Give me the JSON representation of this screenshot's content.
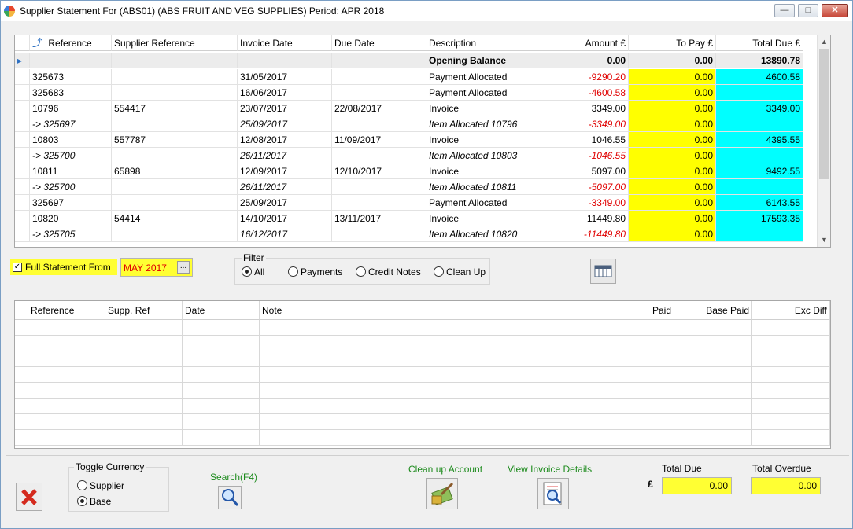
{
  "window": {
    "title": "Supplier Statement For (ABS01) (ABS  FRUIT AND VEG SUPPLIES) Period: APR 2018"
  },
  "statement_grid": {
    "columns": [
      "Reference",
      "Supplier Reference",
      "Invoice Date",
      "Due Date",
      "Description",
      "Amount £",
      "To Pay £",
      "Total Due £"
    ],
    "opening": {
      "description": "Opening Balance",
      "amount": "0.00",
      "to_pay": "0.00",
      "total_due": "13890.78"
    },
    "rows": [
      {
        "ref": "325673",
        "supp_ref": "",
        "inv_date": "31/05/2017",
        "due_date": "",
        "desc": "Payment Allocated",
        "amount": "-9290.20",
        "to_pay": "0.00",
        "total_due": "4600.58",
        "italic": false
      },
      {
        "ref": "325683",
        "supp_ref": "",
        "inv_date": "16/06/2017",
        "due_date": "",
        "desc": "Payment Allocated",
        "amount": "-4600.58",
        "to_pay": "0.00",
        "total_due": "",
        "italic": false
      },
      {
        "ref": "10796",
        "supp_ref": "554417",
        "inv_date": "23/07/2017",
        "due_date": "22/08/2017",
        "desc": "Invoice",
        "amount": "3349.00",
        "to_pay": "0.00",
        "total_due": "3349.00",
        "italic": false
      },
      {
        "ref": "-> 325697",
        "supp_ref": "",
        "inv_date": "25/09/2017",
        "due_date": "",
        "desc": "Item Allocated 10796",
        "amount": "-3349.00",
        "to_pay": "0.00",
        "total_due": "",
        "italic": true
      },
      {
        "ref": "10803",
        "supp_ref": "557787",
        "inv_date": "12/08/2017",
        "due_date": "11/09/2017",
        "desc": "Invoice",
        "amount": "1046.55",
        "to_pay": "0.00",
        "total_due": "4395.55",
        "italic": false
      },
      {
        "ref": "-> 325700",
        "supp_ref": "",
        "inv_date": "26/11/2017",
        "due_date": "",
        "desc": "Item Allocated 10803",
        "amount": "-1046.55",
        "to_pay": "0.00",
        "total_due": "",
        "italic": true
      },
      {
        "ref": "10811",
        "supp_ref": "65898",
        "inv_date": "12/09/2017",
        "due_date": "12/10/2017",
        "desc": "Invoice",
        "amount": "5097.00",
        "to_pay": "0.00",
        "total_due": "9492.55",
        "italic": false
      },
      {
        "ref": "-> 325700",
        "supp_ref": "",
        "inv_date": "26/11/2017",
        "due_date": "",
        "desc": "Item Allocated 10811",
        "amount": "-5097.00",
        "to_pay": "0.00",
        "total_due": "",
        "italic": true
      },
      {
        "ref": "325697",
        "supp_ref": "",
        "inv_date": "25/09/2017",
        "due_date": "",
        "desc": "Payment Allocated",
        "amount": "-3349.00",
        "to_pay": "0.00",
        "total_due": "6143.55",
        "italic": false
      },
      {
        "ref": "10820",
        "supp_ref": "54414",
        "inv_date": "14/10/2017",
        "due_date": "13/11/2017",
        "desc": "Invoice",
        "amount": "11449.80",
        "to_pay": "0.00",
        "total_due": "17593.35",
        "italic": false
      },
      {
        "ref": "-> 325705",
        "supp_ref": "",
        "inv_date": "16/12/2017",
        "due_date": "",
        "desc": "Item Allocated 10820",
        "amount": "-11449.80",
        "to_pay": "0.00",
        "total_due": "",
        "italic": true
      }
    ]
  },
  "statement_options": {
    "full_statement_label": "Full Statement From",
    "full_statement_checked": true,
    "from_date": "MAY 2017",
    "date_picker_label": "...",
    "filter_legend": "Filter",
    "filters": [
      "All",
      "Payments",
      "Credit Notes",
      "Clean Up"
    ],
    "selected_filter": "All"
  },
  "allocation_grid": {
    "columns": [
      "Reference",
      "Supp. Ref",
      "Date",
      "Note",
      "Paid",
      "Base Paid",
      "Exc Diff"
    ]
  },
  "footer": {
    "toggle_currency_legend": "Toggle Currency",
    "currency_options": [
      "Supplier",
      "Base"
    ],
    "selected_currency": "Base",
    "search_label": "Search(F4)",
    "cleanup_label": "Clean up Account",
    "view_invoice_label": "View Invoice Details",
    "currency_symbol": "£",
    "total_due_label": "Total Due",
    "total_due_value": "0.00",
    "total_overdue_label": "Total Overdue",
    "total_overdue_value": "0.00"
  },
  "colors": {
    "to_pay_bg": "#ffff00",
    "total_due_bg": "#00ffff",
    "negative": "#e00000",
    "highlight": "#ffff33",
    "action_label": "#1b8a1b"
  }
}
